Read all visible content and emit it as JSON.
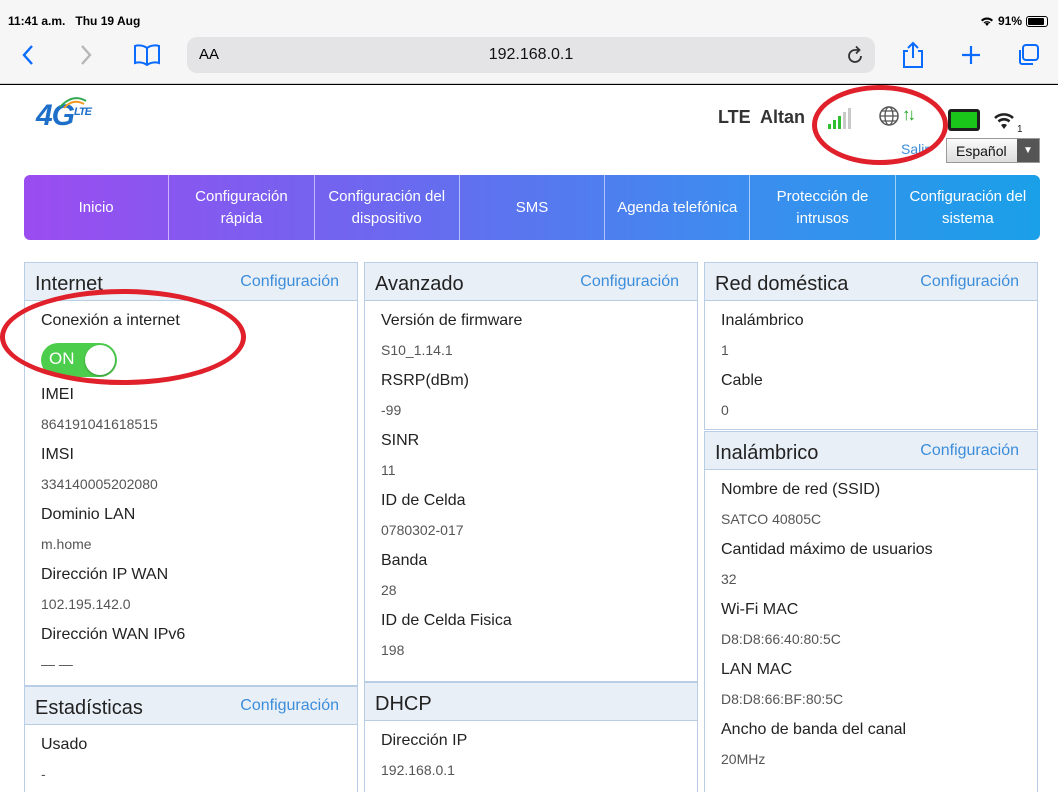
{
  "status_bar": {
    "time": "11:41 a.m.",
    "date": "Thu 19 Aug",
    "battery": "91%"
  },
  "browser": {
    "text_size": "AA",
    "url": "192.168.0.1"
  },
  "header": {
    "logo_main": "4G",
    "logo_sub": "LTE",
    "network_type": "LTE",
    "carrier": "Altan",
    "logout": "Salir",
    "language": "Español"
  },
  "nav": [
    "Inicio",
    "Configuración rápida",
    "Configuración del dispositivo",
    "SMS",
    "Agenda telefónica",
    "Protección de intrusos",
    "Configuración del sistema"
  ],
  "internet": {
    "title": "Internet",
    "config": "Configuración",
    "connection_label": "Conexión a internet",
    "toggle": "ON",
    "imei_label": "IMEI",
    "imei": "864191041618515",
    "imsi_label": "IMSI",
    "imsi": "334140005202080",
    "lan_domain_label": "Dominio LAN",
    "lan_domain": "m.home",
    "wan_ip_label": "Dirección IP WAN",
    "wan_ip": "102.195.142.0",
    "wan_ipv6_label": "Dirección WAN IPv6",
    "wan_ipv6": "— —"
  },
  "stats": {
    "title": "Estadísticas",
    "config": "Configuración",
    "used_label": "Usado",
    "used": "-"
  },
  "advanced": {
    "title": "Avanzado",
    "config": "Configuración",
    "fw_label": "Versión de firmware",
    "fw": "S10_1.14.1",
    "rsrp_label": "RSRP(dBm)",
    "rsrp": "-99",
    "sinr_label": "SINR",
    "sinr": "11",
    "cell_label": "ID de Celda",
    "cell": "0780302-017",
    "band_label": "Banda",
    "band": "28",
    "pcell_label": "ID de Celda Fisica",
    "pcell": "198"
  },
  "dhcp": {
    "title": "DHCP",
    "ip_label": "Dirección IP",
    "ip": "192.168.0.1"
  },
  "home_network": {
    "title": "Red doméstica",
    "config": "Configuración",
    "wireless_label": "Inalámbrico",
    "wireless": "1",
    "cable_label": "Cable",
    "cable": "0"
  },
  "wireless": {
    "title": "Inalámbrico",
    "config": "Configuración",
    "ssid_label": "Nombre de red (SSID)",
    "ssid": "SATCO 40805C",
    "max_users_label": "Cantidad máximo de usuarios",
    "max_users": "32",
    "wifi_mac_label": "Wi-Fi MAC",
    "wifi_mac": "D8:D8:66:40:80:5C",
    "lan_mac_label": "LAN MAC",
    "lan_mac": "D8:D8:66:BF:80:5C",
    "bandwidth_label": "Ancho de banda del canal",
    "bandwidth": "20MHz"
  }
}
